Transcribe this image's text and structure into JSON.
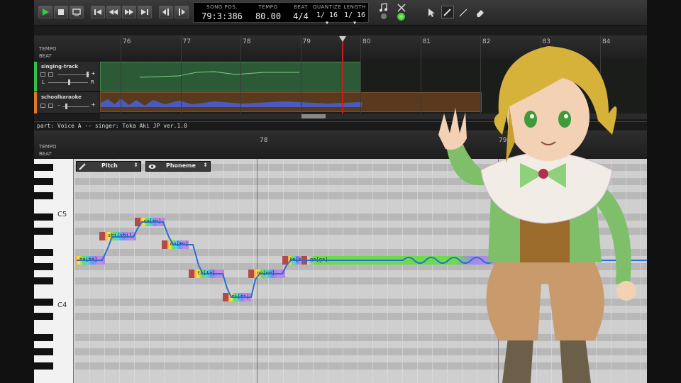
{
  "toolbar": {
    "buttons": [
      "play-button",
      "stop-button",
      "loop-button",
      "goto-start-button",
      "rewind-button",
      "fast-forward-button",
      "goto-end-button",
      "snap-left-button",
      "snap-right-button"
    ],
    "lcd": {
      "song_pos_label": "SONG POS.",
      "song_pos": "79:3:386",
      "tempo_label": "TEMPO",
      "tempo": "80.00",
      "beat_label": "BEAT",
      "beat": "4/4",
      "quantize_label": "QUANTIZE",
      "quantize": "1/ 16 ▾",
      "length_label": "LENGTH",
      "length": "1/ 16 ▾"
    }
  },
  "arrangement": {
    "tempo_label": "TEMPO",
    "beat_label": "BEAT",
    "measures": [
      "76",
      "77",
      "78",
      "79",
      "80",
      "81",
      "82",
      "83",
      "84"
    ],
    "tracks": [
      {
        "name": "singing-track",
        "pan_l": "L",
        "pan_r": "R",
        "plus": "+",
        "minus": "–"
      },
      {
        "name": "schoolkaraoke",
        "plus": "+",
        "minus": "–"
      }
    ]
  },
  "part_info": "part: Voice A  --  singer: Toka Aki JP ver.1.0",
  "piano_roll": {
    "tempo_label": "TEMPO",
    "beat_label": "BEAT",
    "measures": [
      "78",
      "79"
    ],
    "key_labels": [
      "C5",
      "C4"
    ],
    "pitch_dropdown": "Pitch",
    "phoneme_dropdown": "Phoneme",
    "notes": [
      {
        "lyric": "ha[ha]"
      },
      {
        "lyric": "shi[shi]"
      },
      {
        "lyric": "ru[ru]"
      },
      {
        "lyric": "mo[mo]"
      },
      {
        "lyric": "ta[ta]"
      },
      {
        "lyric": "ri[ri]"
      },
      {
        "lyric": "no[no]"
      },
      {
        "lyric": "ke[ke]"
      },
      {
        "lyric": "ga[ga]"
      }
    ]
  },
  "colors": {
    "accent_green": "#35c04a",
    "pitch_line": "#2a6fd6",
    "note_cap": "#b24a4a",
    "playhead": "#c02020"
  }
}
